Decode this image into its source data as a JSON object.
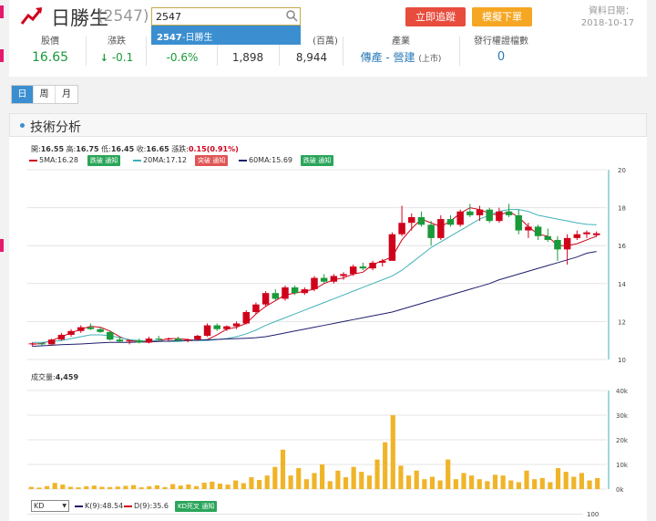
{
  "header": {
    "stock_name": "日勝生",
    "stock_code": "(2547)",
    "search_value": "2547",
    "suggestion_code": "2547",
    "suggestion_name": "-日勝生",
    "track_button": "立即追蹤",
    "simulate_button": "模擬下單",
    "date_label": "資料日期：",
    "date_value": "2018-10-17"
  },
  "quote": {
    "price_label": "股價",
    "price": "16.65",
    "change_label": "漲跌",
    "change": "-0.1",
    "pct": "-0.6%",
    "volume": "1,898",
    "amount_label": "(百萬)",
    "amount": "8,944",
    "industry_label": "產業",
    "industry": "傳產 - 營建",
    "industry_market": "(上市)",
    "warrant_label": "發行權證檔數",
    "warrant_count": "0"
  },
  "period_tabs": [
    "日",
    "周",
    "月"
  ],
  "section_title": "技術分析",
  "ohlc": {
    "open_label": "開:",
    "open": "16.55",
    "high_label": "高:",
    "high": "16.75",
    "low_label": "低:",
    "low": "16.45",
    "close_label": "收:",
    "close": "16.65",
    "chg_label": "漲跌:",
    "chg": "0.15(0.91%)"
  },
  "ma": [
    {
      "label": "5MA:16.28",
      "signal": "跌破 通知",
      "signal_color": "#2aa55a",
      "color": "#d0021b"
    },
    {
      "label": "20MA:17.12",
      "signal": "突破 通知",
      "signal_color": "#e05555",
      "color": "#3fb2b8"
    },
    {
      "label": "60MA:15.69",
      "signal": "跌破 通知",
      "signal_color": "#2aa55a",
      "color": "#1f1e6b"
    }
  ],
  "volume_label": "成交量:",
  "volume_value": "4,459",
  "kd": {
    "selected": "KD",
    "k": "K(9):48.54",
    "d": "D(9):35.6",
    "signal": "KD死叉 通知"
  },
  "colors": {
    "up": "#d0021b",
    "down": "#1a9a3a",
    "volume": "#f0b429",
    "ma5": "#d0021b",
    "ma20": "#3fb2b8",
    "ma60": "#1f1e6b",
    "k": "#1f1e6b",
    "d": "#d0021b"
  },
  "chart_data": [
    {
      "type": "line",
      "title": "",
      "y_ticks": [
        "20",
        "18",
        "16",
        "14",
        "12",
        "10"
      ],
      "ylim": [
        10,
        20
      ],
      "grid": true,
      "series": [
        {
          "name": "5MA",
          "values": [
            10.8,
            10.85,
            11.0,
            11.2,
            11.4,
            11.6,
            11.75,
            11.7,
            11.5,
            11.2,
            11.0,
            10.95,
            10.9,
            11.0,
            11.1,
            11.1,
            11.05,
            11.0,
            11.05,
            11.3,
            11.6,
            11.7,
            11.9,
            12.4,
            12.8,
            13.1,
            13.4,
            13.5,
            13.6,
            13.7,
            14.0,
            14.2,
            14.3,
            14.5,
            14.6,
            15.0,
            15.2,
            15.4,
            16.3,
            16.9,
            17.4,
            17.2,
            17.0,
            17.3,
            17.7,
            18.0,
            17.9,
            17.7,
            17.6,
            17.8,
            17.5,
            17.0,
            16.6,
            16.5,
            16.0,
            16.0,
            16.1,
            16.3,
            16.5
          ]
        },
        {
          "name": "20MA",
          "values": [
            10.9,
            10.9,
            10.95,
            11.0,
            11.1,
            11.2,
            11.3,
            11.3,
            11.25,
            11.15,
            11.05,
            11.0,
            11.0,
            11.0,
            10.95,
            10.95,
            11.0,
            11.0,
            11.0,
            11.05,
            11.1,
            11.2,
            11.35,
            11.55,
            11.8,
            12.0,
            12.2,
            12.4,
            12.6,
            12.8,
            13.0,
            13.2,
            13.4,
            13.6,
            13.8,
            14.0,
            14.2,
            14.4,
            14.7,
            15.1,
            15.5,
            15.9,
            16.2,
            16.5,
            16.8,
            17.1,
            17.4,
            17.6,
            17.8,
            17.9,
            17.9,
            17.8,
            17.6,
            17.5,
            17.4,
            17.3,
            17.2,
            17.12,
            17.1
          ]
        },
        {
          "name": "60MA",
          "values": [
            10.7,
            10.72,
            10.75,
            10.78,
            10.8,
            10.82,
            10.85,
            10.88,
            10.9,
            10.9,
            10.9,
            10.92,
            10.93,
            10.95,
            10.97,
            11.0,
            11.0,
            11.02,
            11.04,
            11.06,
            11.08,
            11.1,
            11.12,
            11.15,
            11.2,
            11.3,
            11.4,
            11.5,
            11.6,
            11.7,
            11.8,
            11.9,
            12.0,
            12.1,
            12.2,
            12.3,
            12.4,
            12.5,
            12.65,
            12.8,
            12.95,
            13.1,
            13.25,
            13.4,
            13.55,
            13.7,
            13.85,
            14.0,
            14.2,
            14.35,
            14.5,
            14.65,
            14.8,
            14.95,
            15.1,
            15.25,
            15.4,
            15.6,
            15.69
          ]
        }
      ],
      "candles": [
        [
          10.8,
          10.9,
          10.7,
          10.85
        ],
        [
          10.85,
          10.9,
          10.75,
          10.8
        ],
        [
          10.8,
          11.1,
          10.75,
          11.05
        ],
        [
          11.05,
          11.4,
          11.0,
          11.3
        ],
        [
          11.3,
          11.6,
          11.2,
          11.5
        ],
        [
          11.5,
          11.8,
          11.4,
          11.7
        ],
        [
          11.7,
          11.9,
          11.55,
          11.6
        ],
        [
          11.6,
          11.7,
          11.4,
          11.45
        ],
        [
          11.45,
          11.5,
          11.0,
          11.05
        ],
        [
          11.05,
          11.2,
          10.9,
          10.95
        ],
        [
          10.95,
          11.05,
          10.8,
          11.0
        ],
        [
          11.0,
          11.1,
          10.85,
          10.9
        ],
        [
          10.9,
          11.2,
          10.85,
          11.1
        ],
        [
          11.1,
          11.25,
          11.0,
          11.05
        ],
        [
          11.05,
          11.15,
          10.95,
          11.1
        ],
        [
          11.1,
          11.2,
          11.0,
          11.0
        ],
        [
          11.0,
          11.1,
          10.9,
          11.05
        ],
        [
          11.05,
          11.3,
          11.0,
          11.25
        ],
        [
          11.25,
          11.9,
          11.2,
          11.8
        ],
        [
          11.8,
          11.9,
          11.5,
          11.6
        ],
        [
          11.6,
          11.8,
          11.5,
          11.75
        ],
        [
          11.75,
          12.0,
          11.6,
          11.9
        ],
        [
          11.9,
          12.6,
          11.85,
          12.5
        ],
        [
          12.5,
          13.0,
          12.4,
          12.9
        ],
        [
          12.9,
          13.6,
          12.8,
          13.5
        ],
        [
          13.5,
          13.7,
          13.1,
          13.2
        ],
        [
          13.2,
          13.9,
          13.1,
          13.8
        ],
        [
          13.8,
          13.9,
          13.4,
          13.5
        ],
        [
          13.5,
          13.8,
          13.4,
          13.7
        ],
        [
          13.7,
          14.4,
          13.6,
          14.3
        ],
        [
          14.3,
          14.5,
          14.0,
          14.1
        ],
        [
          14.1,
          14.5,
          14.0,
          14.4
        ],
        [
          14.4,
          14.6,
          14.2,
          14.5
        ],
        [
          14.5,
          15.0,
          14.4,
          14.9
        ],
        [
          14.9,
          15.1,
          14.7,
          14.8
        ],
        [
          14.8,
          15.2,
          14.7,
          15.1
        ],
        [
          15.1,
          15.3,
          14.9,
          15.2
        ],
        [
          15.2,
          16.7,
          15.2,
          16.6
        ],
        [
          16.6,
          18.1,
          16.5,
          17.2
        ],
        [
          17.2,
          17.7,
          16.8,
          17.5
        ],
        [
          17.5,
          17.8,
          17.0,
          17.1
        ],
        [
          17.1,
          17.3,
          16.0,
          16.4
        ],
        [
          16.4,
          17.6,
          16.3,
          17.4
        ],
        [
          17.4,
          17.6,
          17.0,
          17.1
        ],
        [
          17.1,
          17.9,
          17.0,
          17.8
        ],
        [
          17.8,
          18.2,
          17.5,
          17.6
        ],
        [
          17.6,
          18.1,
          17.3,
          17.9
        ],
        [
          17.9,
          18.0,
          17.2,
          17.3
        ],
        [
          17.3,
          18.0,
          17.2,
          17.8
        ],
        [
          17.8,
          18.2,
          17.5,
          17.6
        ],
        [
          17.6,
          17.9,
          16.6,
          16.8
        ],
        [
          16.8,
          17.2,
          16.4,
          17.0
        ],
        [
          17.0,
          17.1,
          16.3,
          16.5
        ],
        [
          16.5,
          16.9,
          16.2,
          16.3
        ],
        [
          16.3,
          16.5,
          15.2,
          15.8
        ],
        [
          15.8,
          16.6,
          15.0,
          16.4
        ],
        [
          16.4,
          16.8,
          16.3,
          16.6
        ],
        [
          16.6,
          16.8,
          16.4,
          16.7
        ],
        [
          16.55,
          16.75,
          16.45,
          16.65
        ]
      ]
    },
    {
      "type": "bar",
      "title": "",
      "y_ticks": [
        "40k",
        "30k",
        "20k",
        "10k",
        "0k"
      ],
      "ylim": [
        0,
        40000
      ],
      "grid": true,
      "values": [
        900,
        600,
        1200,
        2500,
        1800,
        900,
        700,
        1100,
        1400,
        900,
        800,
        1000,
        1300,
        1600,
        700,
        1100,
        1500,
        800,
        2000,
        1400,
        1900,
        1200,
        2600,
        3000,
        2200,
        1800,
        3500,
        2400,
        4800,
        3700,
        5500,
        9000,
        16000,
        5500,
        8500,
        4000,
        6500,
        10000,
        3200,
        7500,
        4800,
        9000,
        7000,
        5500,
        12000,
        19000,
        30000,
        9500,
        5500,
        7500,
        4000,
        5000,
        3500,
        12000,
        4000,
        6500,
        5500,
        4000,
        3200,
        5800,
        5500,
        3500,
        2800,
        7500,
        4000,
        4500,
        2800,
        8500,
        7000,
        5000,
        6500,
        3500,
        4459
      ]
    }
  ]
}
